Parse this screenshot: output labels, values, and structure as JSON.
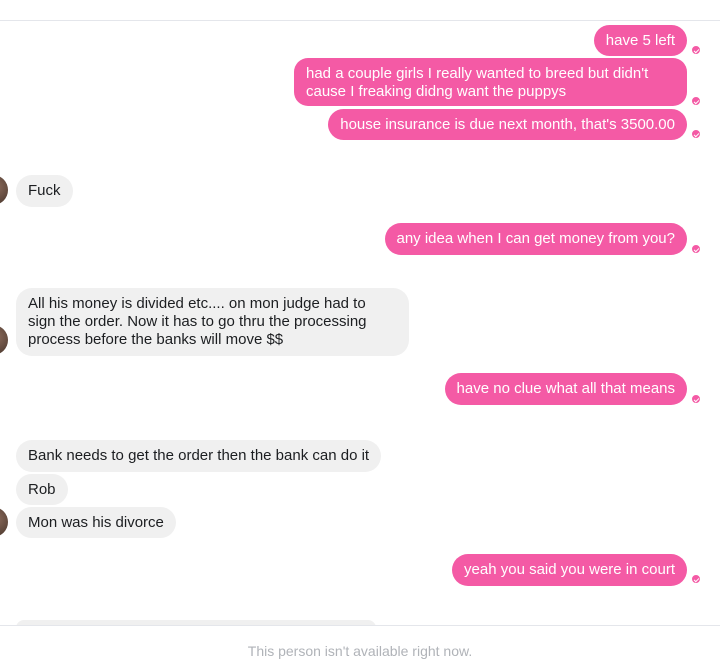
{
  "messages": [
    {
      "from": "me",
      "text": "have 5 left"
    },
    {
      "from": "me",
      "text": "had a couple girls I really wanted to breed but didn't cause I freaking didng want the puppys"
    },
    {
      "from": "me",
      "text": "house insurance is due next month, that's 3500.00"
    },
    {
      "from": "them",
      "text": "Fuck"
    },
    {
      "from": "me",
      "text": "any idea when I can get money from you?"
    },
    {
      "from": "them",
      "text": "All his money is divided etc.... on mon judge had to sign the order. Now it has to go thru the processing process before the banks will move $$"
    },
    {
      "from": "me",
      "text": "have no clue what all that means"
    },
    {
      "from": "them",
      "text": "Bank needs to get the order then the bank can do it"
    },
    {
      "from": "them",
      "text": "Rob"
    },
    {
      "from": "them",
      "text": "Mon was his divorce"
    },
    {
      "from": "me",
      "text": "yeah you said you were in court"
    }
  ],
  "footer": {
    "status_text": "This person isn't available right now."
  },
  "colors": {
    "outgoing_bubble": "#f45aa5",
    "incoming_bubble": "#f0f0f0",
    "footer_text": "#b0b3b8"
  }
}
